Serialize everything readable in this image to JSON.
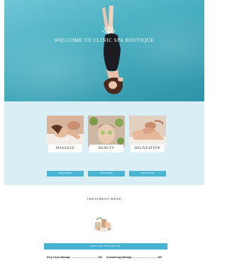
{
  "hero": {
    "title": "WELCOME TO CLINIC SPA BOUTIQUE",
    "subtitle": "",
    "colors": {
      "water": "#46aebf",
      "text": "#ffffff"
    }
  },
  "services": {
    "background": "#d9eef5",
    "cards": [
      {
        "label": "MASSAGE",
        "desc": "",
        "button": "READ MORE"
      },
      {
        "label": "BEAUTY",
        "desc": "",
        "button": "READ MORE"
      },
      {
        "label": "RELAXATION",
        "desc": "",
        "button": "READ MORE"
      }
    ]
  },
  "menu": {
    "title": "TREATMENT MENU",
    "subtitle": "",
    "bar_label": "MASSAGE TREATMENTS",
    "items": [
      {
        "name": "Deep Tissue Massage",
        "price": "$40",
        "desc": ""
      },
      {
        "name": "Aromatherapy Massage",
        "price": "$40",
        "desc": ""
      }
    ],
    "accent": "#47b3d3"
  }
}
